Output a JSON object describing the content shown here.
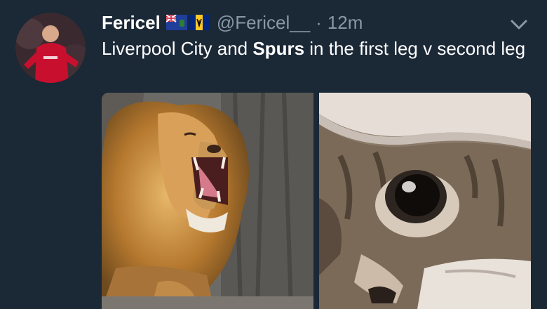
{
  "tweet": {
    "author_name": "Fericel",
    "handle": "@Fericel__",
    "separator": "·",
    "timestamp": "12m",
    "text_before": "Liverpool City and ",
    "text_bold": "Spurs",
    "text_after": " in the first leg v second leg",
    "media": [
      {
        "icon": "lion-roaring-image"
      },
      {
        "icon": "kitten-peeking-image"
      }
    ]
  },
  "colors": {
    "background": "#1b2836",
    "secondary_text": "#8899a6",
    "primary_text": "#ffffff"
  }
}
